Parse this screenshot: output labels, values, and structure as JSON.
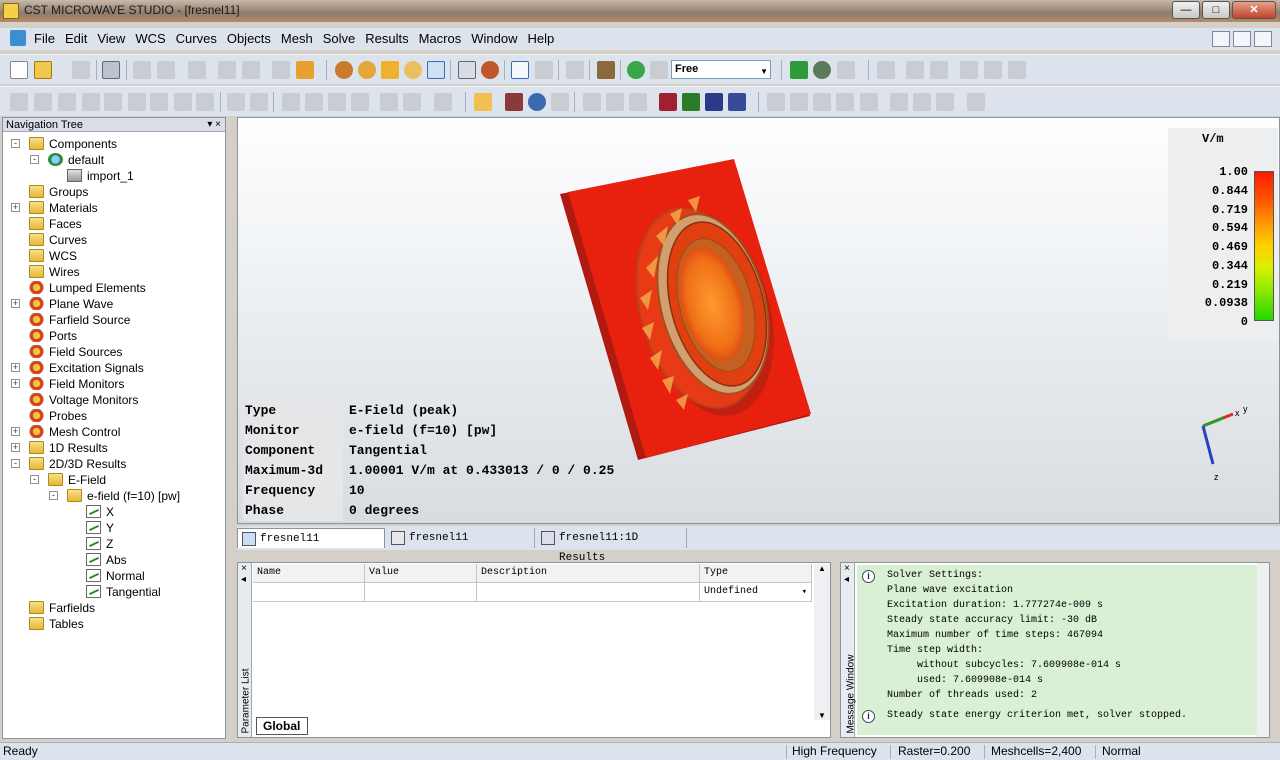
{
  "window": {
    "title": "CST MICROWAVE STUDIO - [fresnel11]",
    "btn_min": "—",
    "btn_max": "□",
    "btn_close": "✕"
  },
  "menu": {
    "items": [
      "File",
      "Edit",
      "View",
      "WCS",
      "Curves",
      "Objects",
      "Mesh",
      "Solve",
      "Results",
      "Macros",
      "Window",
      "Help"
    ]
  },
  "toolbar": {
    "mode_combo": "Free"
  },
  "nav_tree": {
    "header": "Navigation Tree",
    "header_buttons": "▾  ×",
    "items": [
      {
        "label": "Components",
        "icon": "folder-icon",
        "depth": 0,
        "expand": "-"
      },
      {
        "label": "default",
        "icon": "component-icon",
        "depth": 1,
        "expand": "-"
      },
      {
        "label": "import_1",
        "icon": "solid-part-icon",
        "depth": 2,
        "expand": ""
      },
      {
        "label": "Groups",
        "icon": "folder-icon",
        "depth": 0,
        "expand": ""
      },
      {
        "label": "Materials",
        "icon": "folder-icon",
        "depth": 0,
        "expand": "+"
      },
      {
        "label": "Faces",
        "icon": "folder-icon",
        "depth": 0,
        "expand": ""
      },
      {
        "label": "Curves",
        "icon": "folder-icon",
        "depth": 0,
        "expand": ""
      },
      {
        "label": "WCS",
        "icon": "folder-icon",
        "depth": 0,
        "expand": ""
      },
      {
        "label": "Wires",
        "icon": "folder-icon",
        "depth": 0,
        "expand": ""
      },
      {
        "label": "Lumped Elements",
        "icon": "gear-icon",
        "depth": 0,
        "expand": ""
      },
      {
        "label": "Plane Wave",
        "icon": "gear-icon",
        "depth": 0,
        "expand": "+"
      },
      {
        "label": "Farfield Source",
        "icon": "gear-icon",
        "depth": 0,
        "expand": ""
      },
      {
        "label": "Ports",
        "icon": "gear-icon",
        "depth": 0,
        "expand": ""
      },
      {
        "label": "Field Sources",
        "icon": "gear-icon",
        "depth": 0,
        "expand": ""
      },
      {
        "label": "Excitation Signals",
        "icon": "gear-icon",
        "depth": 0,
        "expand": "+"
      },
      {
        "label": "Field Monitors",
        "icon": "gear-icon",
        "depth": 0,
        "expand": "+"
      },
      {
        "label": "Voltage Monitors",
        "icon": "gear-icon",
        "depth": 0,
        "expand": ""
      },
      {
        "label": "Probes",
        "icon": "gear-icon",
        "depth": 0,
        "expand": ""
      },
      {
        "label": "Mesh Control",
        "icon": "gear-icon",
        "depth": 0,
        "expand": "+"
      },
      {
        "label": "1D Results",
        "icon": "folder-icon",
        "depth": 0,
        "expand": "+"
      },
      {
        "label": "2D/3D Results",
        "icon": "folder-icon",
        "depth": 0,
        "expand": "-"
      },
      {
        "label": "E-Field",
        "icon": "folder-icon",
        "depth": 1,
        "expand": "-"
      },
      {
        "label": "e-field (f=10) [pw]",
        "icon": "folder-icon",
        "depth": 2,
        "expand": "-"
      },
      {
        "label": "X",
        "icon": "field-icon",
        "depth": 3,
        "expand": ""
      },
      {
        "label": "Y",
        "icon": "field-icon",
        "depth": 3,
        "expand": ""
      },
      {
        "label": "Z",
        "icon": "field-icon",
        "depth": 3,
        "expand": ""
      },
      {
        "label": "Abs",
        "icon": "field-icon",
        "depth": 3,
        "expand": ""
      },
      {
        "label": "Normal",
        "icon": "field-icon",
        "depth": 3,
        "expand": ""
      },
      {
        "label": "Tangential",
        "icon": "field-icon",
        "depth": 3,
        "expand": ""
      },
      {
        "label": "Farfields",
        "icon": "folder-icon",
        "depth": 0,
        "expand": ""
      },
      {
        "label": "Tables",
        "icon": "folder-icon",
        "depth": 0,
        "expand": ""
      }
    ]
  },
  "viewport": {
    "info": [
      {
        "key": "Type",
        "value": "E-Field (peak)"
      },
      {
        "key": "Monitor",
        "value": "e-field (f=10) [pw]"
      },
      {
        "key": "Component",
        "value": "Tangential"
      },
      {
        "key": "Maximum-3d",
        "value": "1.00001 V/m at 0.433013 / 0 / 0.25"
      },
      {
        "key": "Frequency",
        "value": "10"
      },
      {
        "key": "Phase",
        "value": "0 degrees"
      }
    ],
    "legend": {
      "unit": "V/m",
      "ticks": [
        "1.00",
        "0.844",
        "0.719",
        "0.594",
        "0.469",
        "0.344",
        "0.219",
        "0.0938",
        "0"
      ]
    },
    "axes": {
      "x": "x",
      "y": "y",
      "z": "z"
    }
  },
  "doc_tabs": [
    "fresnel11",
    "fresnel11",
    "fresnel11:1D Results"
  ],
  "param_list": {
    "side_label": "Parameter List",
    "side_buttons": "×  ◂",
    "headers": [
      "Name",
      "Value",
      "Description",
      "Type"
    ],
    "row": [
      "",
      "",
      "",
      "Undefined"
    ],
    "global_tab": "Global",
    "scroll_up": "▲",
    "scroll_down": "▼",
    "dropdown": "▾"
  },
  "message_window": {
    "side_label": "Message Window",
    "side_buttons": "×  ◂",
    "info_glyph": "i",
    "lines": [
      "Solver Settings:",
      "Plane wave excitation",
      "Excitation duration: 1.777274e-009 s",
      "Steady state accuracy limit: -30 dB",
      "Maximum number of time steps: 467094",
      "Time step width:",
      "     without subcycles: 7.609908e-014 s",
      "     used: 7.609908e-014 s",
      "Number of threads used: 2"
    ],
    "last_line": "Steady state energy criterion met, solver stopped."
  },
  "status": {
    "left": "Ready",
    "freq": "High Frequency",
    "raster": "Raster=0.200",
    "mesh": "Meshcells=2,400",
    "mode": "Normal"
  }
}
